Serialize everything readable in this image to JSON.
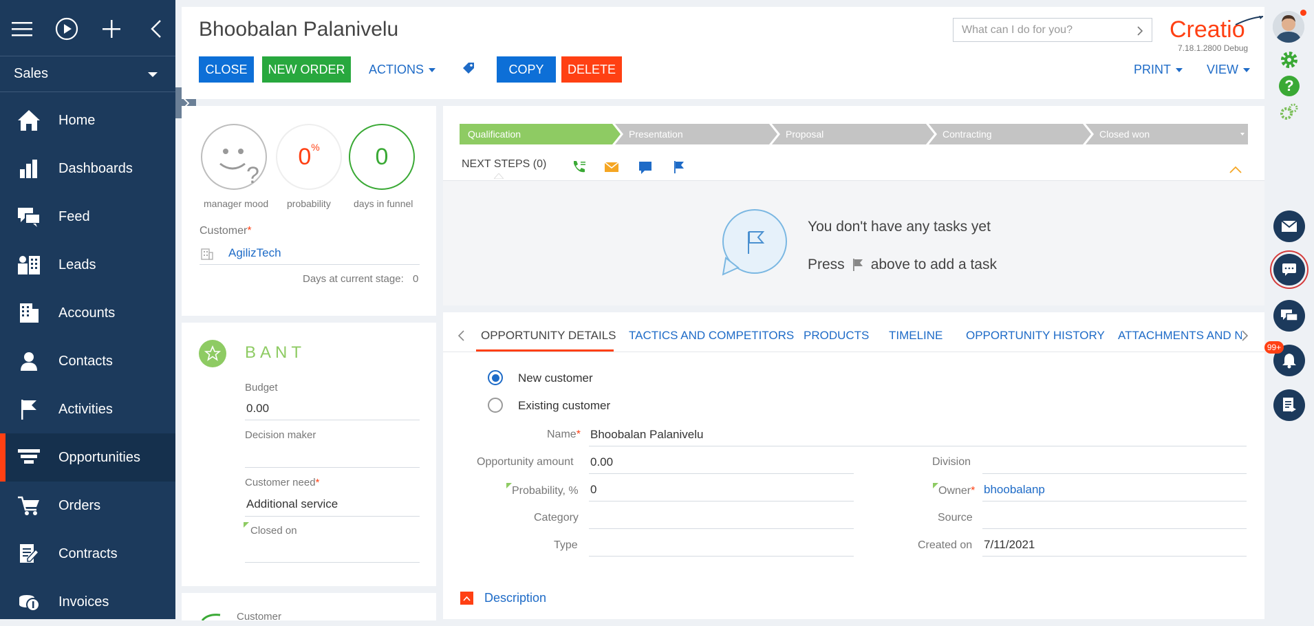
{
  "nav": {
    "workspace": "Sales",
    "items": [
      {
        "label": "Home",
        "icon": "home-icon"
      },
      {
        "label": "Dashboards",
        "icon": "dashboards-icon"
      },
      {
        "label": "Feed",
        "icon": "feed-icon"
      },
      {
        "label": "Leads",
        "icon": "leads-icon"
      },
      {
        "label": "Accounts",
        "icon": "accounts-icon"
      },
      {
        "label": "Contacts",
        "icon": "contacts-icon"
      },
      {
        "label": "Activities",
        "icon": "flag-icon"
      },
      {
        "label": "Opportunities",
        "icon": "opportunities-icon"
      },
      {
        "label": "Orders",
        "icon": "cart-icon"
      },
      {
        "label": "Contracts",
        "icon": "contracts-icon"
      },
      {
        "label": "Invoices",
        "icon": "invoices-icon"
      }
    ]
  },
  "header": {
    "title": "Bhoobalan Palanivelu",
    "close_label": "CLOSE",
    "new_order_label": "NEW ORDER",
    "actions_label": "ACTIONS",
    "copy_label": "COPY",
    "delete_label": "DELETE",
    "print_label": "PRINT",
    "view_label": "VIEW",
    "search_placeholder": "What can I do for you?",
    "logo": "Creatio",
    "version": "7.18.1.2800 Debug"
  },
  "summary": {
    "mood_label": "manager mood",
    "probability_value": "0",
    "probability_unit": "%",
    "probability_label": "probability",
    "days_value": "0",
    "days_label": "days in funnel",
    "customer_label": "Customer",
    "customer_value": "AgilizTech",
    "days_stage_label": "Days at current stage:",
    "days_stage_value": "0"
  },
  "bant": {
    "title": "BANT",
    "budget_label": "Budget",
    "budget_value": "0.00",
    "decision_maker_label": "Decision maker",
    "decision_maker_value": "",
    "need_label": "Customer need",
    "need_value": "Additional service",
    "closed_on_label": "Closed on",
    "closed_on_value": "",
    "next_label": "Customer"
  },
  "stages": [
    "Qualification",
    "Presentation",
    "Proposal",
    "Contracting",
    "Closed won"
  ],
  "next_steps": {
    "label": "NEXT STEPS (0)",
    "empty_line1": "You don't have any tasks yet",
    "empty_line2_pre": "Press",
    "empty_line2_post": "above to add a task"
  },
  "tabs": [
    "OPPORTUNITY DETAILS",
    "TACTICS AND COMPETITORS",
    "PRODUCTS",
    "TIMELINE",
    "OPPORTUNITY HISTORY",
    "ATTACHMENTS AND NC"
  ],
  "details": {
    "radio_new": "New customer",
    "radio_existing": "Existing customer",
    "name_label": "Name",
    "name_value": "Bhoobalan Palanivelu",
    "amount_label": "Opportunity amount",
    "amount_value": "0.00",
    "probability_label": "Probability, %",
    "probability_value": "0",
    "category_label": "Category",
    "category_value": "",
    "type_label": "Type",
    "type_value": "",
    "division_label": "Division",
    "division_value": "",
    "owner_label": "Owner",
    "owner_value": "bhoobalanp",
    "source_label": "Source",
    "source_value": "",
    "created_label": "Created on",
    "created_value": "7/11/2021",
    "description_label": "Description"
  },
  "rightbar": {
    "notifications_badge": "99+"
  },
  "colors": {
    "nav_bg": "#1c3a5c",
    "accent_orange": "#ff4013",
    "primary_blue": "#0d6fd7",
    "success_green": "#28a83e",
    "stage_active": "#8ecb63",
    "stage_inactive": "#c4c4c4"
  }
}
